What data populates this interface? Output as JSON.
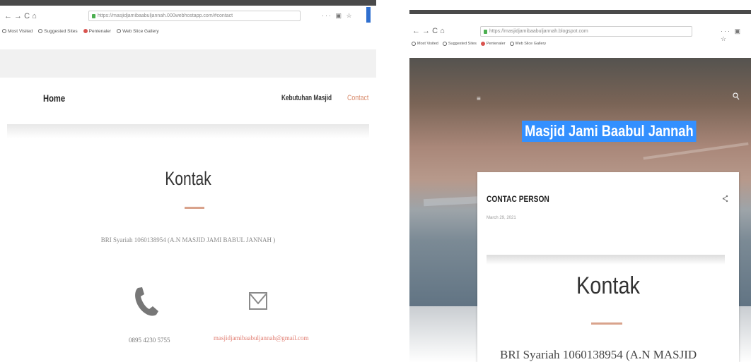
{
  "left": {
    "browser": {
      "nav_buttons": "←  →  C  ⌂",
      "url": "https://masjidjamibaabuljannah.000webhostapp.com/#contact",
      "controls": "··· ▣ ☆",
      "bookmarks": [
        "Most Visited",
        "Suggested Sites",
        "Pentenaler",
        "Web Slice Gallery"
      ]
    },
    "site": {
      "nav_home": "Home",
      "nav_kebutuhan": "Kebutuhan Masjid",
      "nav_contact": "Contact",
      "title": "Kontak",
      "bank": "BRI Syariah 1060138954 (A.N MASJID JAMI BABUL JANNAH )",
      "phone": "0895 4230 5755",
      "email": "masjidjamibaabuljannah@gmail.com"
    }
  },
  "right": {
    "browser": {
      "nav_buttons": "←  →  C  ⌂",
      "url": "https://masjidjamibaabuljannah.blogspot.com",
      "controls": "··· ▣ ☆",
      "bookmarks": [
        "Most Visited",
        "Suggested Sites",
        "Pentenaler",
        "Web Slice Gallery"
      ]
    },
    "blog": {
      "menu_icon": "≡",
      "title": "Masjid Jami Baabul Jannah",
      "post_title": "CONTAC PERSON",
      "post_date": "March 29, 2021",
      "post_heading": "Kontak",
      "post_bank": "BRI Syariah 1060138954 (A.N MASJID"
    }
  },
  "colors": {
    "accent": "#d98b6c",
    "divider": "#d9a38c",
    "email": "#e07a6e",
    "selection": "#3390ff"
  }
}
